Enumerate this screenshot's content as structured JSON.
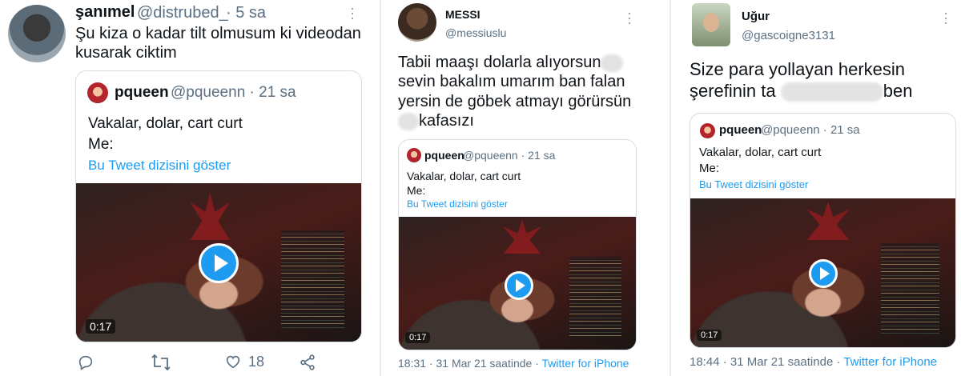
{
  "tweets": [
    {
      "display_name": "şanımel",
      "handle": "@distrubed_",
      "time": "· 5 sa",
      "text": "Şu kiza o kadar tilt olmusum ki videodan kusarak ciktim",
      "quote": {
        "name": "pqueen",
        "handle": "@pqueenn · 21 sa",
        "line1": "Vakalar, dolar, cart curt",
        "line2": "Me:",
        "link": "Bu Tweet dizisini göster",
        "duration": "0:17"
      },
      "actions": {
        "like_count": "18"
      }
    },
    {
      "display_name": "MESSI",
      "handle": "@messiuslu",
      "text_lines": [
        "Tabii maaşı dolarla alıyorsun",
        "sevin bakalım umarım ban falan",
        "yersin de göbek atmayı görürsün",
        "kafasızı"
      ],
      "quote": {
        "name": "pqueen",
        "handle": "@pqueenn · 21 sa",
        "line1": "Vakalar, dolar, cart curt",
        "line2": "Me:",
        "link": "Bu Tweet dizisini göster",
        "duration": "0:17"
      },
      "meta_time": "18:31 · 31 Mar 21 saatinde · ",
      "meta_source": "Twitter for iPhone"
    },
    {
      "display_name": "Uğur",
      "handle": "@gascoigne3131",
      "text_line1": "Size para yollayan herkesin",
      "text_line2_start": "şerefinin ta",
      "text_line2_end": "ben",
      "quote": {
        "name": "pqueen",
        "handle": "@pqueenn · 21 sa",
        "line1": "Vakalar, dolar, cart curt",
        "line2": "Me:",
        "link": "Bu Tweet dizisini göster",
        "duration": "0:17"
      },
      "meta_time": "18:44 · 31 Mar 21 saatinde · ",
      "meta_source": "Twitter for iPhone"
    }
  ],
  "icons": [
    "more-icon",
    "reply-icon",
    "retweet-icon",
    "like-icon",
    "share-icon",
    "play-icon"
  ],
  "colors": {
    "link": "#1d9bf0",
    "secondary_text": "#5b7083",
    "border": "#d6dde3"
  }
}
